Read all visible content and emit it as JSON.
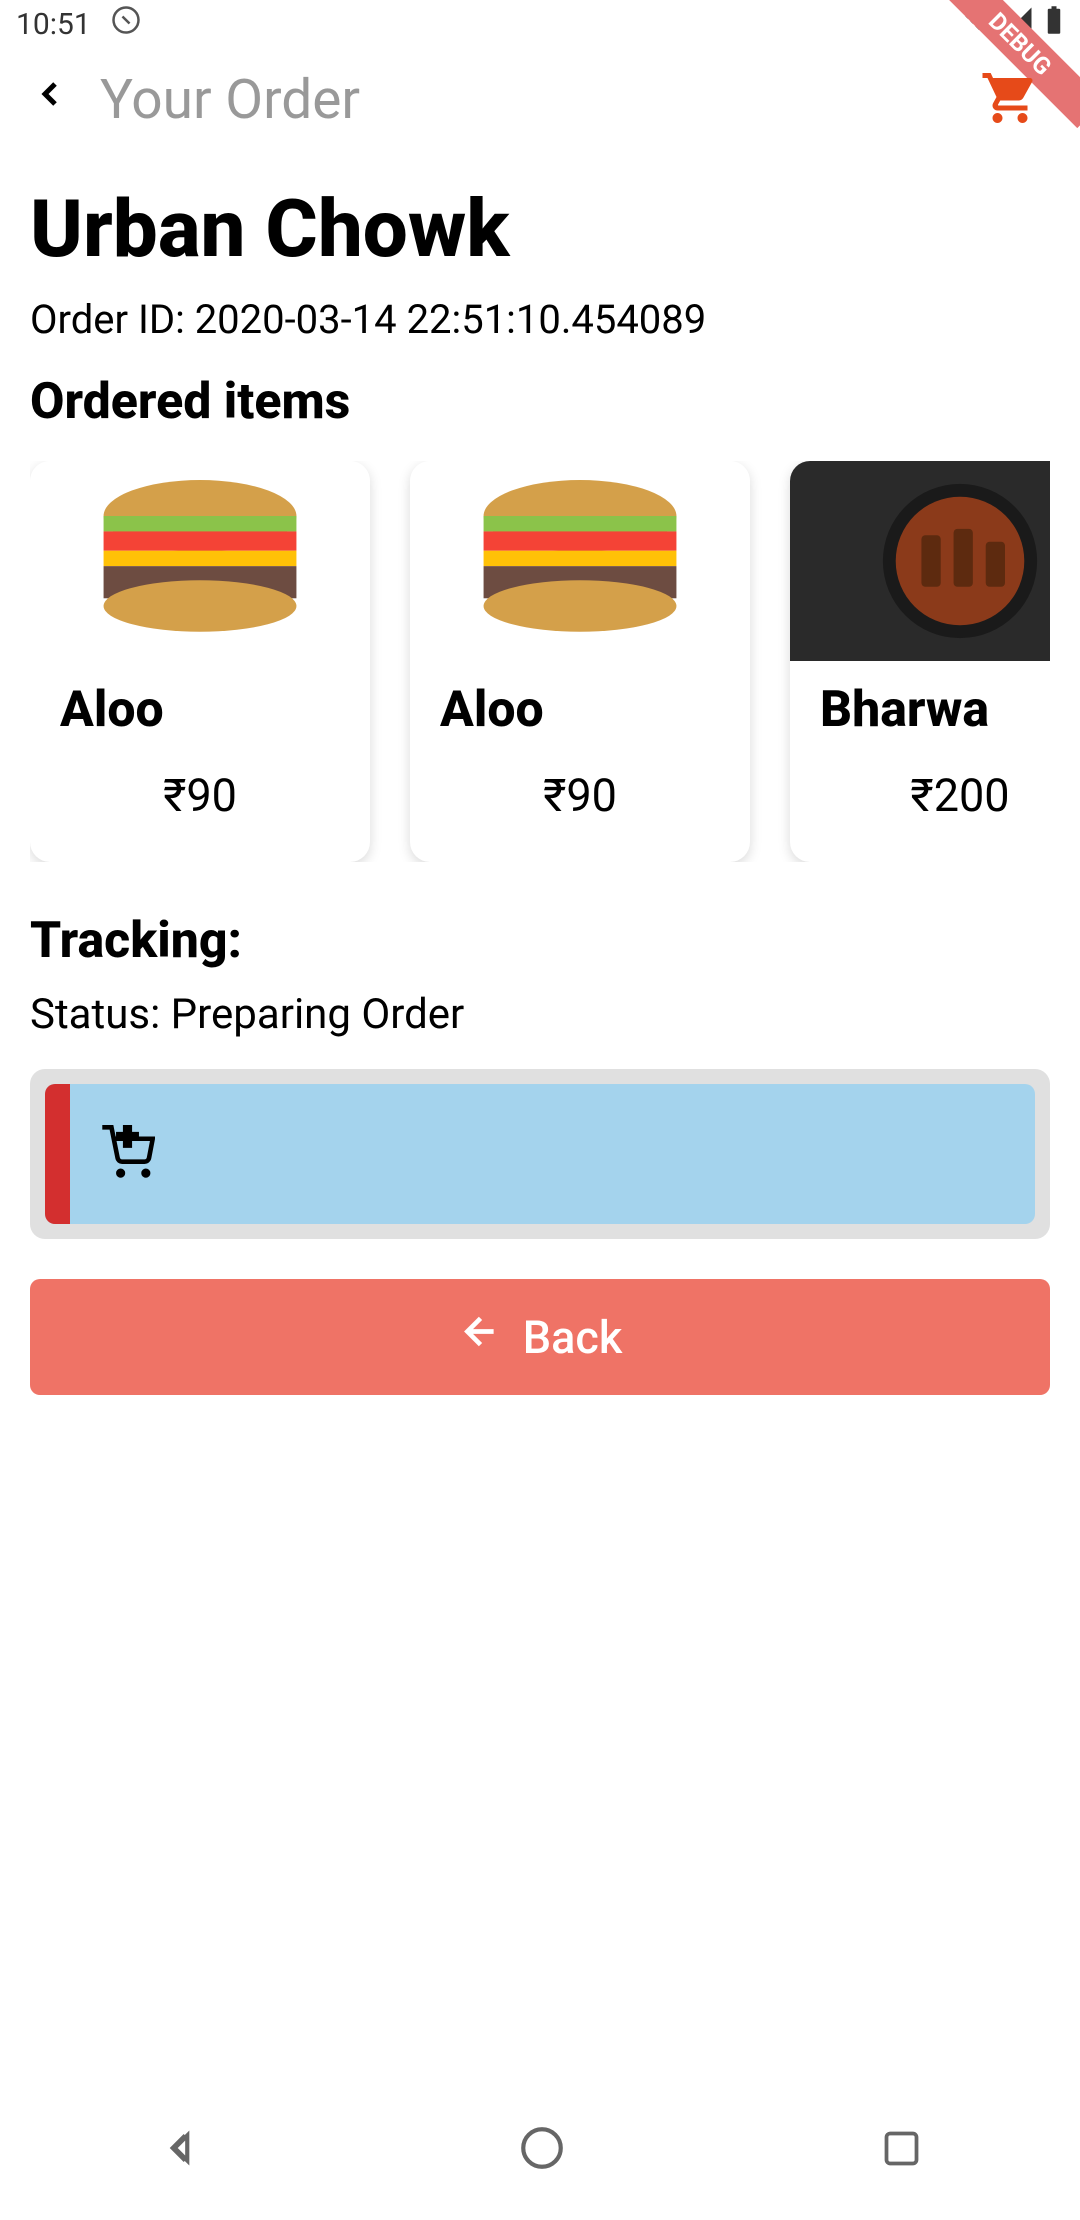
{
  "status_bar": {
    "time": "10:51"
  },
  "header": {
    "title": "Your Order",
    "debug_label": "DEBUG"
  },
  "order": {
    "restaurant_name": "Urban Chowk",
    "order_id_label": "Order ID: 2020-03-14 22:51:10.454089",
    "items_section_title": "Ordered items",
    "items": [
      {
        "name": "Aloo",
        "price": "₹90",
        "image_type": "burger"
      },
      {
        "name": "Aloo",
        "price": "₹90",
        "image_type": "burger"
      },
      {
        "name": "Bharwa",
        "price": "₹200",
        "image_type": "curry"
      }
    ]
  },
  "tracking": {
    "title": "Tracking:",
    "status": "Status: Preparing Order"
  },
  "back_button": {
    "label": "Back"
  }
}
